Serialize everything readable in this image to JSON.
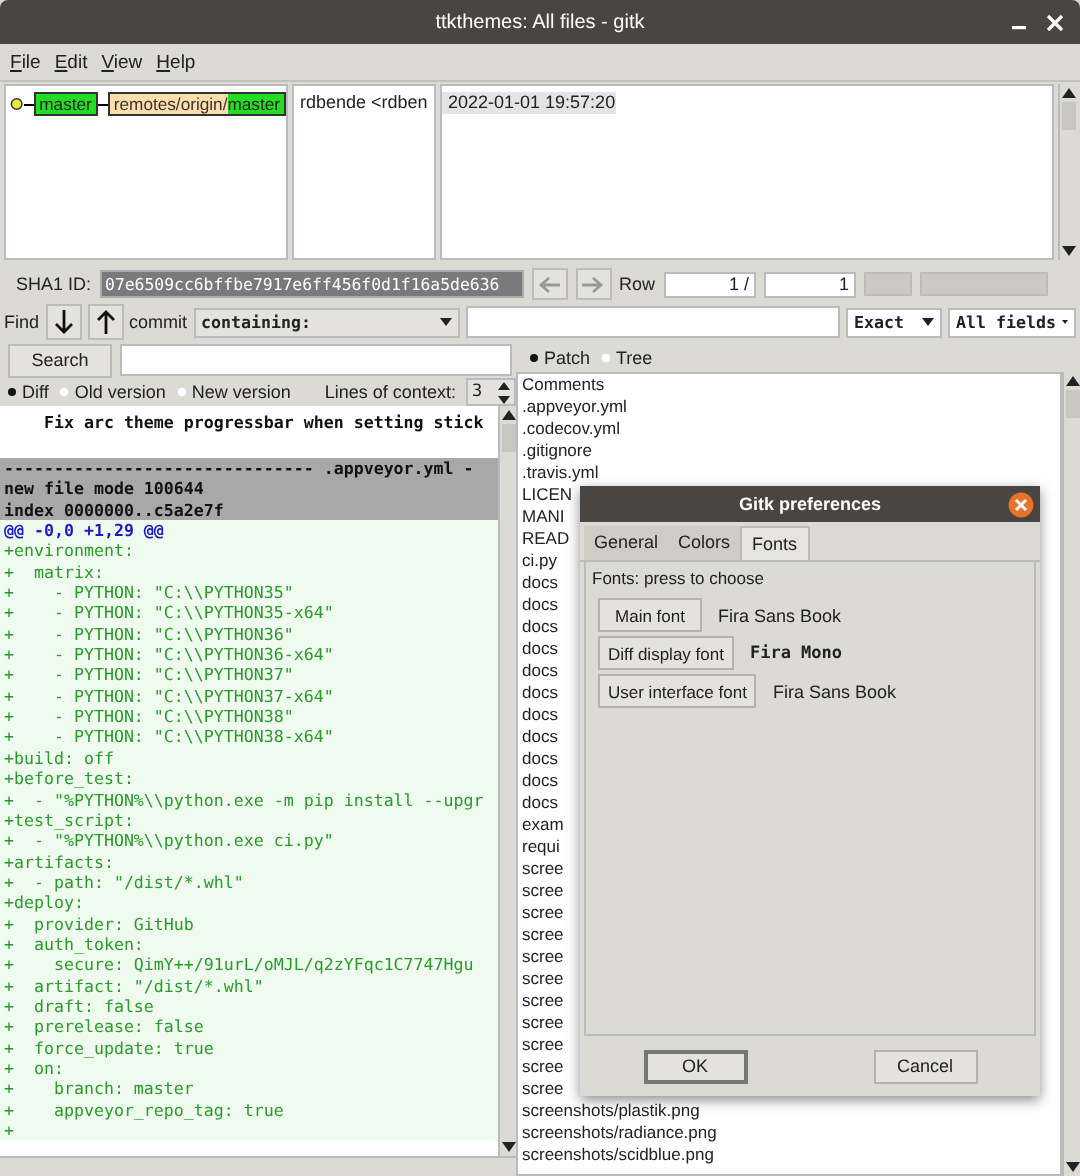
{
  "window": {
    "title": "ttkthemes: All files - gitk"
  },
  "menu": [
    "File",
    "Edit",
    "View",
    "Help"
  ],
  "commits": [
    {
      "refs": [
        {
          "kind": "head",
          "name": "master"
        },
        {
          "kind": "remote",
          "prefix": "remotes/origin/",
          "name": "master"
        }
      ],
      "author": "rdbende <rdben",
      "date": "2022-01-01 19:57:20"
    }
  ],
  "sha1": {
    "label": "SHA1 ID:",
    "value": "07e6509cc6bffbe7917e6ff456f0d1f16a5de636"
  },
  "row": {
    "label": "Row",
    "current": "1 /",
    "total": "1"
  },
  "progress_bars": [
    {
      "level": 0
    },
    {
      "level": 0
    }
  ],
  "find": {
    "label": "Find",
    "scope": "commit",
    "mode": "containing:",
    "match": "Exact",
    "fields": "All fields"
  },
  "search": {
    "button": "Search"
  },
  "diff_view": {
    "options": [
      {
        "label": "Diff",
        "selected": true
      },
      {
        "label": "Old version",
        "selected": false
      },
      {
        "label": "New version",
        "selected": false
      }
    ],
    "context_label": "Lines of context:",
    "context": "3",
    "lines": [
      {
        "kind": "comment",
        "text": "    Fix arc theme progressbar when setting stick"
      },
      {
        "kind": "blank"
      },
      {
        "kind": "header",
        "text": "------------------------------- .appveyor.yml -"
      },
      {
        "kind": "header",
        "text": "new file mode 100644"
      },
      {
        "kind": "header",
        "text": "index 0000000..c5a2e7f"
      },
      {
        "kind": "hunk",
        "text": "@@ -0,0 +1,29 @@"
      },
      {
        "kind": "add",
        "text": "+environment:"
      },
      {
        "kind": "add",
        "text": "+  matrix:"
      },
      {
        "kind": "add",
        "text": "+    - PYTHON: \"C:\\\\PYTHON35\""
      },
      {
        "kind": "add",
        "text": "+    - PYTHON: \"C:\\\\PYTHON35-x64\""
      },
      {
        "kind": "add",
        "text": "+    - PYTHON: \"C:\\\\PYTHON36\""
      },
      {
        "kind": "add",
        "text": "+    - PYTHON: \"C:\\\\PYTHON36-x64\""
      },
      {
        "kind": "add",
        "text": "+    - PYTHON: \"C:\\\\PYTHON37\""
      },
      {
        "kind": "add",
        "text": "+    - PYTHON: \"C:\\\\PYTHON37-x64\""
      },
      {
        "kind": "add",
        "text": "+    - PYTHON: \"C:\\\\PYTHON38\""
      },
      {
        "kind": "add",
        "text": "+    - PYTHON: \"C:\\\\PYTHON38-x64\""
      },
      {
        "kind": "add",
        "text": "+build: off"
      },
      {
        "kind": "add",
        "text": "+before_test:"
      },
      {
        "kind": "add",
        "text": "+  - \"%PYTHON%\\\\python.exe -m pip install --upgr"
      },
      {
        "kind": "add",
        "text": "+test_script:"
      },
      {
        "kind": "add",
        "text": "+  - \"%PYTHON%\\\\python.exe ci.py\""
      },
      {
        "kind": "add",
        "text": "+artifacts:"
      },
      {
        "kind": "add",
        "text": "+  - path: \"/dist/*.whl\""
      },
      {
        "kind": "add",
        "text": "+deploy:"
      },
      {
        "kind": "add",
        "text": "+  provider: GitHub"
      },
      {
        "kind": "add",
        "text": "+  auth_token:"
      },
      {
        "kind": "add",
        "text": "+    secure: QimY++/91urL/oMJL/q2zYFqc1C7747Hgu"
      },
      {
        "kind": "add",
        "text": "+  artifact: \"/dist/*.whl\""
      },
      {
        "kind": "add",
        "text": "+  draft: false"
      },
      {
        "kind": "add",
        "text": "+  prerelease: false"
      },
      {
        "kind": "add",
        "text": "+  force_update: true"
      },
      {
        "kind": "add",
        "text": "+  on:"
      },
      {
        "kind": "add",
        "text": "+    branch: master"
      },
      {
        "kind": "add",
        "text": "+    appveyor_repo_tag: true"
      },
      {
        "kind": "add",
        "text": "+"
      }
    ]
  },
  "file_view": {
    "options": [
      {
        "label": "Patch",
        "selected": true
      },
      {
        "label": "Tree",
        "selected": false
      }
    ],
    "files": [
      "Comments",
      ".appveyor.yml",
      ".codecov.yml",
      ".gitignore",
      ".travis.yml",
      "LICEN",
      "MANI",
      "READ",
      "ci.py",
      "docs",
      "docs",
      "docs",
      "docs",
      "docs",
      "docs",
      "docs",
      "docs",
      "docs",
      "docs",
      "docs",
      "exam",
      "requi",
      "scree",
      "scree",
      "scree",
      "scree",
      "scree",
      "scree",
      "scree",
      "scree",
      "scree",
      "scree",
      "scree",
      "screenshots/plastik.png",
      "screenshots/radiance.png",
      "screenshots/scidblue.png"
    ]
  },
  "dialog": {
    "title": "Gitk preferences",
    "tabs": [
      {
        "label": "General",
        "selected": false
      },
      {
        "label": "Colors",
        "selected": false
      },
      {
        "label": "Fonts",
        "selected": true
      }
    ],
    "hint": "Fonts: press to choose",
    "fonts": [
      {
        "button": "Main font",
        "value": "Fira Sans Book",
        "kind": "sans"
      },
      {
        "button": "Diff display font",
        "value": "Fira Mono",
        "kind": "mono"
      },
      {
        "button": "User interface font",
        "value": "Fira Sans Book",
        "kind": "sans"
      }
    ],
    "buttons": [
      {
        "label": "OK",
        "default": true
      },
      {
        "label": "Cancel",
        "default": false
      }
    ]
  }
}
